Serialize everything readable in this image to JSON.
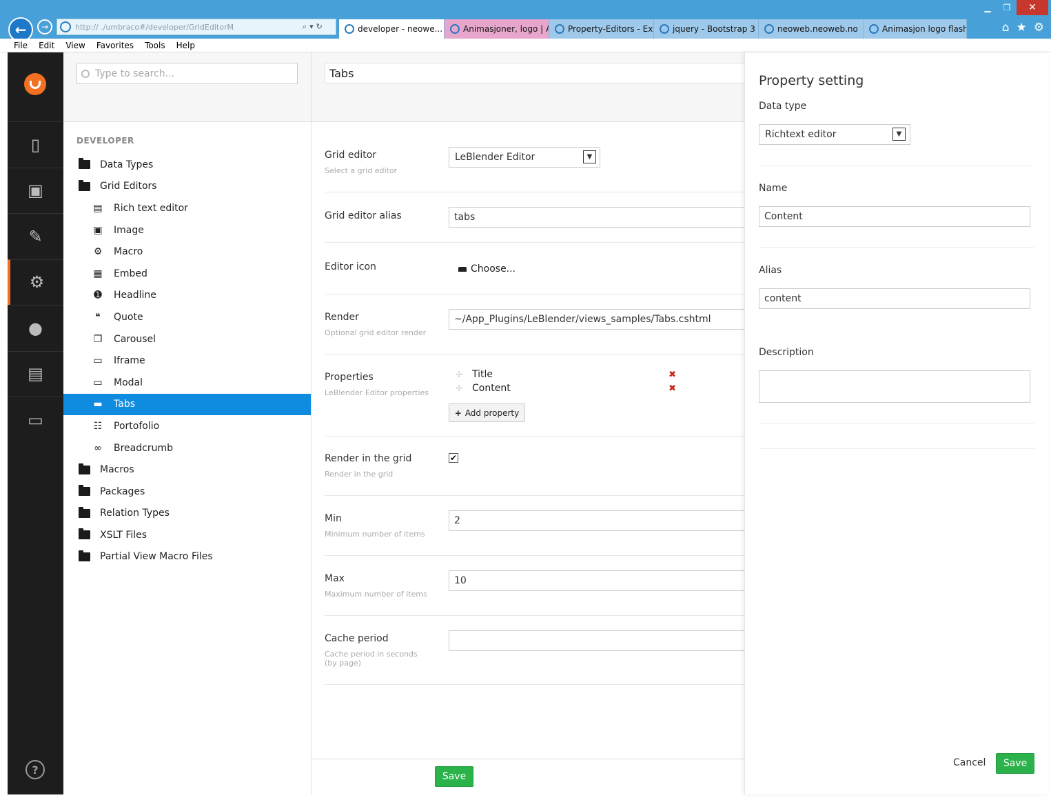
{
  "browser": {
    "address": "http://                    ./umbraco#/developer/GridEditorM",
    "tabs": [
      {
        "label": "developer - neowe...",
        "state": "active"
      },
      {
        "label": "Animasjoner, logo | A...",
        "state": "pink"
      },
      {
        "label": "Property-Editors - Ext...",
        "state": "blue"
      },
      {
        "label": "jquery - Bootstrap 3 a...",
        "state": "blue"
      },
      {
        "label": "neoweb.neoweb.no",
        "state": "blue"
      },
      {
        "label": "Animasjon logo flash ...",
        "state": "blue"
      }
    ],
    "tab_close": "✕",
    "menu": [
      "File",
      "Edit",
      "View",
      "Favorites",
      "Tools",
      "Help"
    ]
  },
  "sections": [
    {
      "icon": "content-icon",
      "glyph": "▯"
    },
    {
      "icon": "media-icon",
      "glyph": "▣"
    },
    {
      "icon": "settings-wrench-icon",
      "glyph": "✎"
    },
    {
      "icon": "developer-gear-icon",
      "glyph": "⚙"
    },
    {
      "icon": "users-icon",
      "glyph": "●"
    },
    {
      "icon": "members-icon",
      "glyph": "▤"
    },
    {
      "icon": "forms-icon",
      "glyph": "▭"
    }
  ],
  "tree": {
    "search_placeholder": "Type to search...",
    "root": "DEVELOPER",
    "nodes": [
      {
        "label": "Data Types",
        "level": 0,
        "icon": "folder-icon"
      },
      {
        "label": "Grid Editors",
        "level": 0,
        "icon": "folder-icon"
      },
      {
        "label": "Rich text editor",
        "level": 1,
        "icon": "rte-icon",
        "glyph": "▤"
      },
      {
        "label": "Image",
        "level": 1,
        "icon": "image-icon",
        "glyph": "▣"
      },
      {
        "label": "Macro",
        "level": 1,
        "icon": "macro-icon",
        "glyph": "⚙"
      },
      {
        "label": "Embed",
        "level": 1,
        "icon": "embed-icon",
        "glyph": "▦"
      },
      {
        "label": "Headline",
        "level": 1,
        "icon": "headline-icon",
        "glyph": "➊"
      },
      {
        "label": "Quote",
        "level": 1,
        "icon": "quote-icon",
        "glyph": "❝"
      },
      {
        "label": "Carousel",
        "level": 1,
        "icon": "carousel-icon",
        "glyph": "❐"
      },
      {
        "label": "Iframe",
        "level": 1,
        "icon": "iframe-icon",
        "glyph": "▭"
      },
      {
        "label": "Modal",
        "level": 1,
        "icon": "modal-icon",
        "glyph": "▭"
      },
      {
        "label": "Tabs",
        "level": 1,
        "icon": "tabs-icon",
        "glyph": "▬",
        "selected": true
      },
      {
        "label": "Portofolio",
        "level": 1,
        "icon": "portfolio-icon",
        "glyph": "☷"
      },
      {
        "label": "Breadcrumb",
        "level": 1,
        "icon": "link-icon",
        "glyph": "∞"
      },
      {
        "label": "Macros",
        "level": 0,
        "icon": "folder-icon"
      },
      {
        "label": "Packages",
        "level": 0,
        "icon": "folder-icon"
      },
      {
        "label": "Relation Types",
        "level": 0,
        "icon": "folder-icon"
      },
      {
        "label": "XSLT Files",
        "level": 0,
        "icon": "folder-icon"
      },
      {
        "label": "Partial View Macro Files",
        "level": 0,
        "icon": "folder-icon"
      }
    ]
  },
  "editor": {
    "name": "Tabs",
    "grid_editor": {
      "label": "Grid editor",
      "desc": "Select a grid editor",
      "value": "LeBlender Editor"
    },
    "alias": {
      "label": "Grid editor alias",
      "value": "tabs"
    },
    "icon": {
      "label": "Editor icon",
      "choose": "Choose..."
    },
    "render": {
      "label": "Render",
      "desc": "Optional grid editor render",
      "value": "~/App_Plugins/LeBlender/views_samples/Tabs.cshtml"
    },
    "properties": {
      "label": "Properties",
      "desc": "LeBlender Editor properties",
      "items": [
        "Title",
        "Content"
      ],
      "delete_glyph": "✖",
      "drag_glyph": "✢",
      "add_label": "Add property",
      "add_glyph": "+"
    },
    "render_grid": {
      "label": "Render in the grid",
      "desc": "Render in the grid",
      "checked": "✔"
    },
    "min": {
      "label": "Min",
      "desc": "Minimum number of items",
      "value": "2"
    },
    "max": {
      "label": "Max",
      "desc": "Maximum number of items",
      "value": "10"
    },
    "cache": {
      "label": "Cache period",
      "desc": "Cache period in seconds (by page)",
      "value": ""
    },
    "save_label": "Save"
  },
  "dialog": {
    "title": "Property setting",
    "data_type_label": "Data type",
    "data_type_value": "Richtext editor",
    "name_label": "Name",
    "name_value": "Content",
    "alias_label": "Alias",
    "alias_value": "content",
    "description_label": "Description",
    "description_value": "",
    "cancel_label": "Cancel",
    "save_label": "Save"
  },
  "colors": {
    "accent": "#0f8ce0",
    "brand": "#f36f21",
    "save": "#2bb24a",
    "delete": "#c8281e"
  }
}
